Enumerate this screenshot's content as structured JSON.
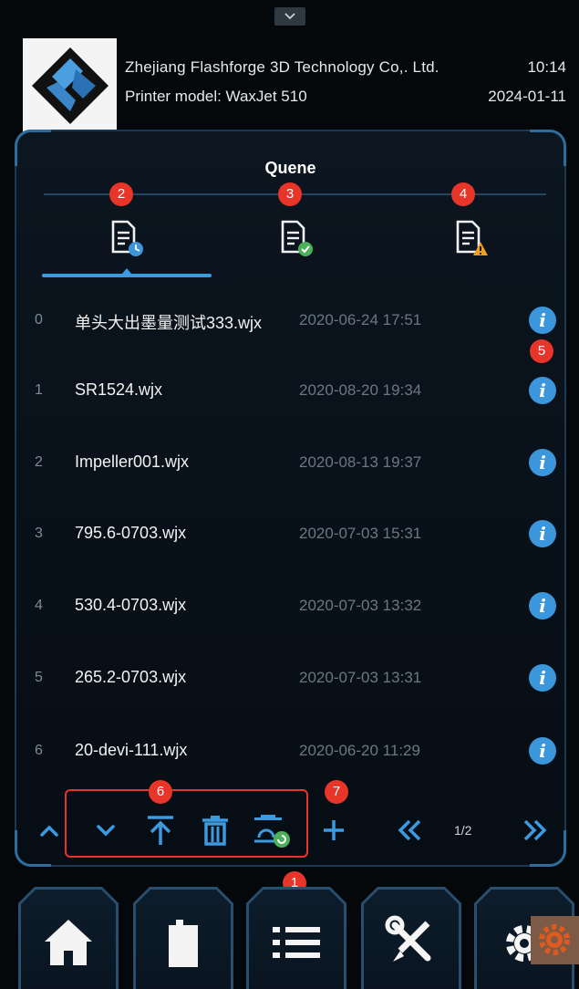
{
  "header": {
    "company": "Zhejiang Flashforge 3D Technology Co,. Ltd.",
    "model": "Printer model: WaxJet 510",
    "time": "10:14",
    "date": "2024-01-11"
  },
  "panel": {
    "title": "Quene",
    "tabs": [
      {
        "icon": "document-clock-icon",
        "status": "queued",
        "active": true
      },
      {
        "icon": "document-check-icon",
        "status": "completed",
        "active": false
      },
      {
        "icon": "document-warning-icon",
        "status": "failed",
        "active": false
      }
    ]
  },
  "files": [
    {
      "index": "0",
      "name": "单头大出墨量测试333.wjx",
      "time": "2020-06-24 17:51"
    },
    {
      "index": "1",
      "name": "SR1524.wjx",
      "time": "2020-08-20 19:34"
    },
    {
      "index": "2",
      "name": "Impeller001.wjx",
      "time": "2020-08-13 19:37"
    },
    {
      "index": "3",
      "name": "795.6-0703.wjx",
      "time": "2020-07-03 15:31"
    },
    {
      "index": "4",
      "name": "530.4-0703.wjx",
      "time": "2020-07-03 13:32"
    },
    {
      "index": "5",
      "name": "265.2-0703.wjx",
      "time": "2020-07-03 13:31"
    },
    {
      "index": "6",
      "name": "20-devi-111.wjx",
      "time": "2020-06-20 11:29"
    }
  ],
  "toolbar": {
    "page": "1/2",
    "icons": [
      "chevron-up-icon",
      "chevron-down-icon",
      "move-to-top-icon",
      "trash-icon",
      "reprint-icon",
      "plus-icon",
      "double-chevron-left-icon",
      "double-chevron-right-icon"
    ]
  },
  "badges": [
    "1",
    "2",
    "3",
    "4",
    "5",
    "6",
    "7"
  ],
  "nav": {
    "items": [
      "home-icon",
      "material-bottle-icon",
      "list-icon",
      "tools-icon",
      "settings-gear-icon"
    ],
    "active": "list-icon"
  },
  "colors": {
    "accent": "#3b96dc",
    "badge": "#e8352a",
    "background": "#05080b"
  }
}
